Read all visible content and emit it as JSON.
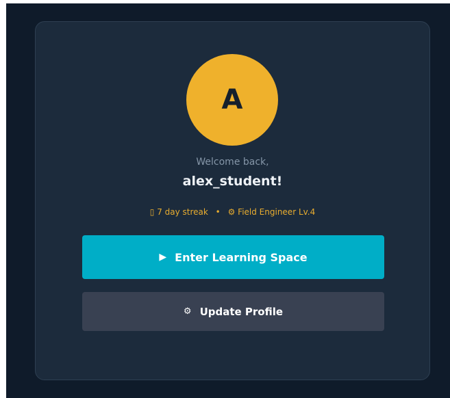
{
  "profile": {
    "avatar_initial": "A",
    "welcome_text": "Welcome back,",
    "username": "alex_student!"
  },
  "stats": {
    "streak_icon": "▯",
    "streak_text": "7 day streak",
    "separator": "•",
    "rank_icon": "⚙",
    "rank_text": "Field Engineer Lv.4"
  },
  "actions": {
    "enter_icon": "▶",
    "enter_label": "Enter Learning Space",
    "update_icon": "⚙",
    "update_label": "Update Profile"
  },
  "colors": {
    "page_background": "#0f1b2a",
    "card_background": "#1c2b3c",
    "avatar": "#efb12c",
    "accent_text": "#e9ad2f",
    "primary_button": "#00aec7",
    "secondary_button": "#394152"
  }
}
